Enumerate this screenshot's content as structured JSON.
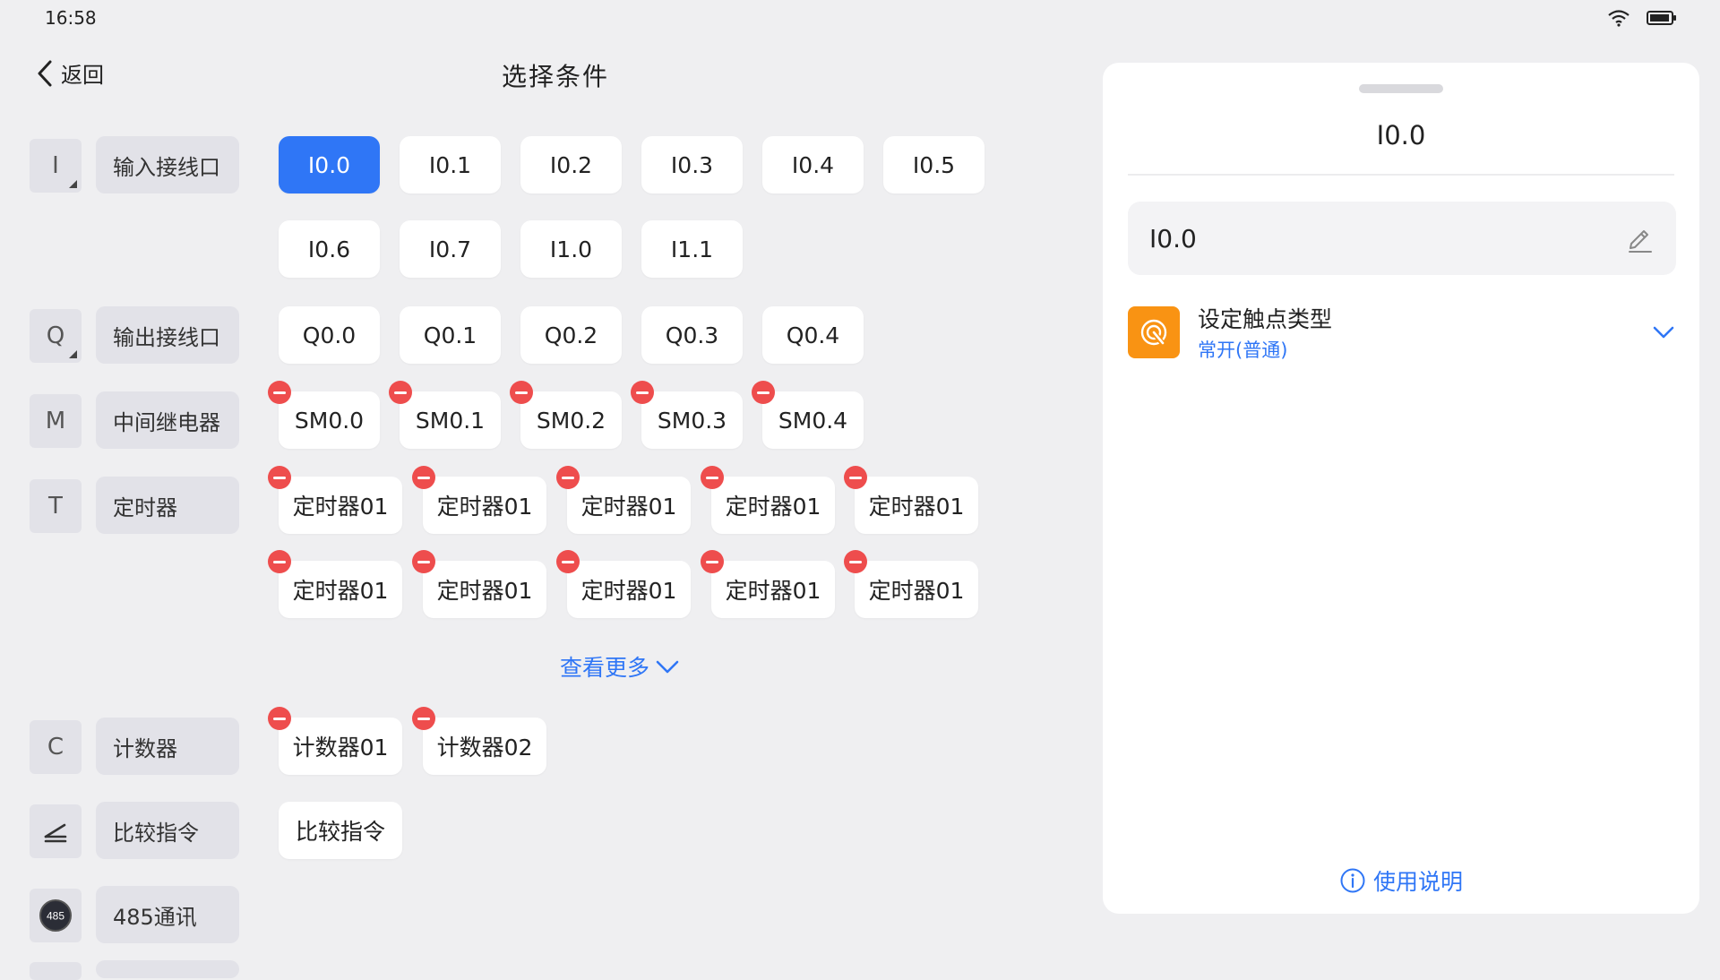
{
  "status": {
    "time": "16:58"
  },
  "header": {
    "back_label": "返回",
    "title": "选择条件"
  },
  "categories": [
    {
      "letter": "I",
      "label": "输入接线口"
    },
    {
      "letter": "Q",
      "label": "输出接线口"
    },
    {
      "letter": "M",
      "label": "中间继电器"
    },
    {
      "letter": "T",
      "label": "定时器"
    },
    {
      "letter": "C",
      "label": "计数器"
    },
    {
      "letter": "",
      "label": "比较指令"
    },
    {
      "letter": "485",
      "label": "485通讯"
    }
  ],
  "inputs": [
    "I0.0",
    "I0.1",
    "I0.2",
    "I0.3",
    "I0.4",
    "I0.5",
    "I0.6",
    "I0.7",
    "I1.0",
    "I1.1"
  ],
  "outputs": [
    "Q0.0",
    "Q0.1",
    "Q0.2",
    "Q0.3",
    "Q0.4"
  ],
  "relays": [
    "SM0.0",
    "SM0.1",
    "SM0.2",
    "SM0.3",
    "SM0.4"
  ],
  "timers": [
    "定时器01",
    "定时器01",
    "定时器01",
    "定时器01",
    "定时器01",
    "定时器01",
    "定时器01",
    "定时器01",
    "定时器01",
    "定时器01"
  ],
  "show_more": "查看更多",
  "counters": [
    "计数器01",
    "计数器02"
  ],
  "compare": [
    "比较指令"
  ],
  "panel": {
    "title": "I0.0",
    "name_value": "I0.0",
    "contact_title": "设定触点类型",
    "contact_value": "常开(普通)",
    "help": "使用说明"
  },
  "colors": {
    "accent": "#2f76f6",
    "remove": "#ee4d4d",
    "contact_icon": "#f99313"
  }
}
